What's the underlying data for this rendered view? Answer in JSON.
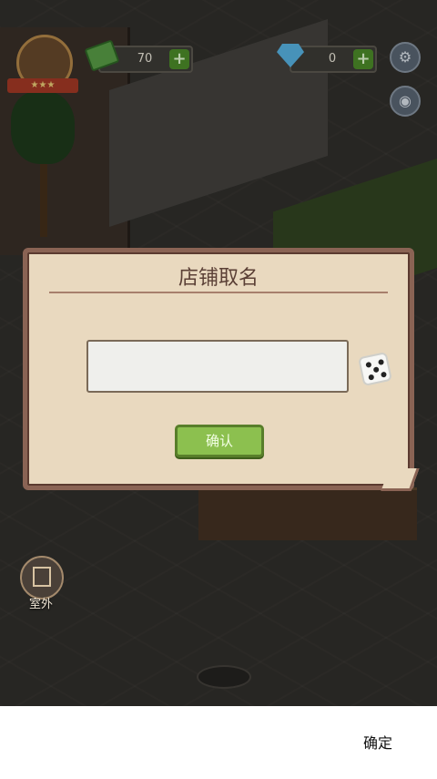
{
  "hud": {
    "cash": {
      "value": "70",
      "plus": "+"
    },
    "gems": {
      "value": "0",
      "plus": "+"
    },
    "settings_icon": "gear-icon",
    "camera_icon": "camera-icon"
  },
  "dialog": {
    "title": "店铺取名",
    "input": {
      "value": "",
      "placeholder": ""
    },
    "dice_icon": "dice-icon",
    "confirm_label": "确认"
  },
  "outdoor_button": {
    "label": "室外",
    "icon": "door-icon"
  },
  "bottom_bar": {
    "ok_label": "确定"
  },
  "colors": {
    "dialog_bg": "#e9d9bf",
    "dialog_border": "#8a6354",
    "confirm_button": "#8cc04f",
    "plus_button": "#4e8f2a"
  }
}
